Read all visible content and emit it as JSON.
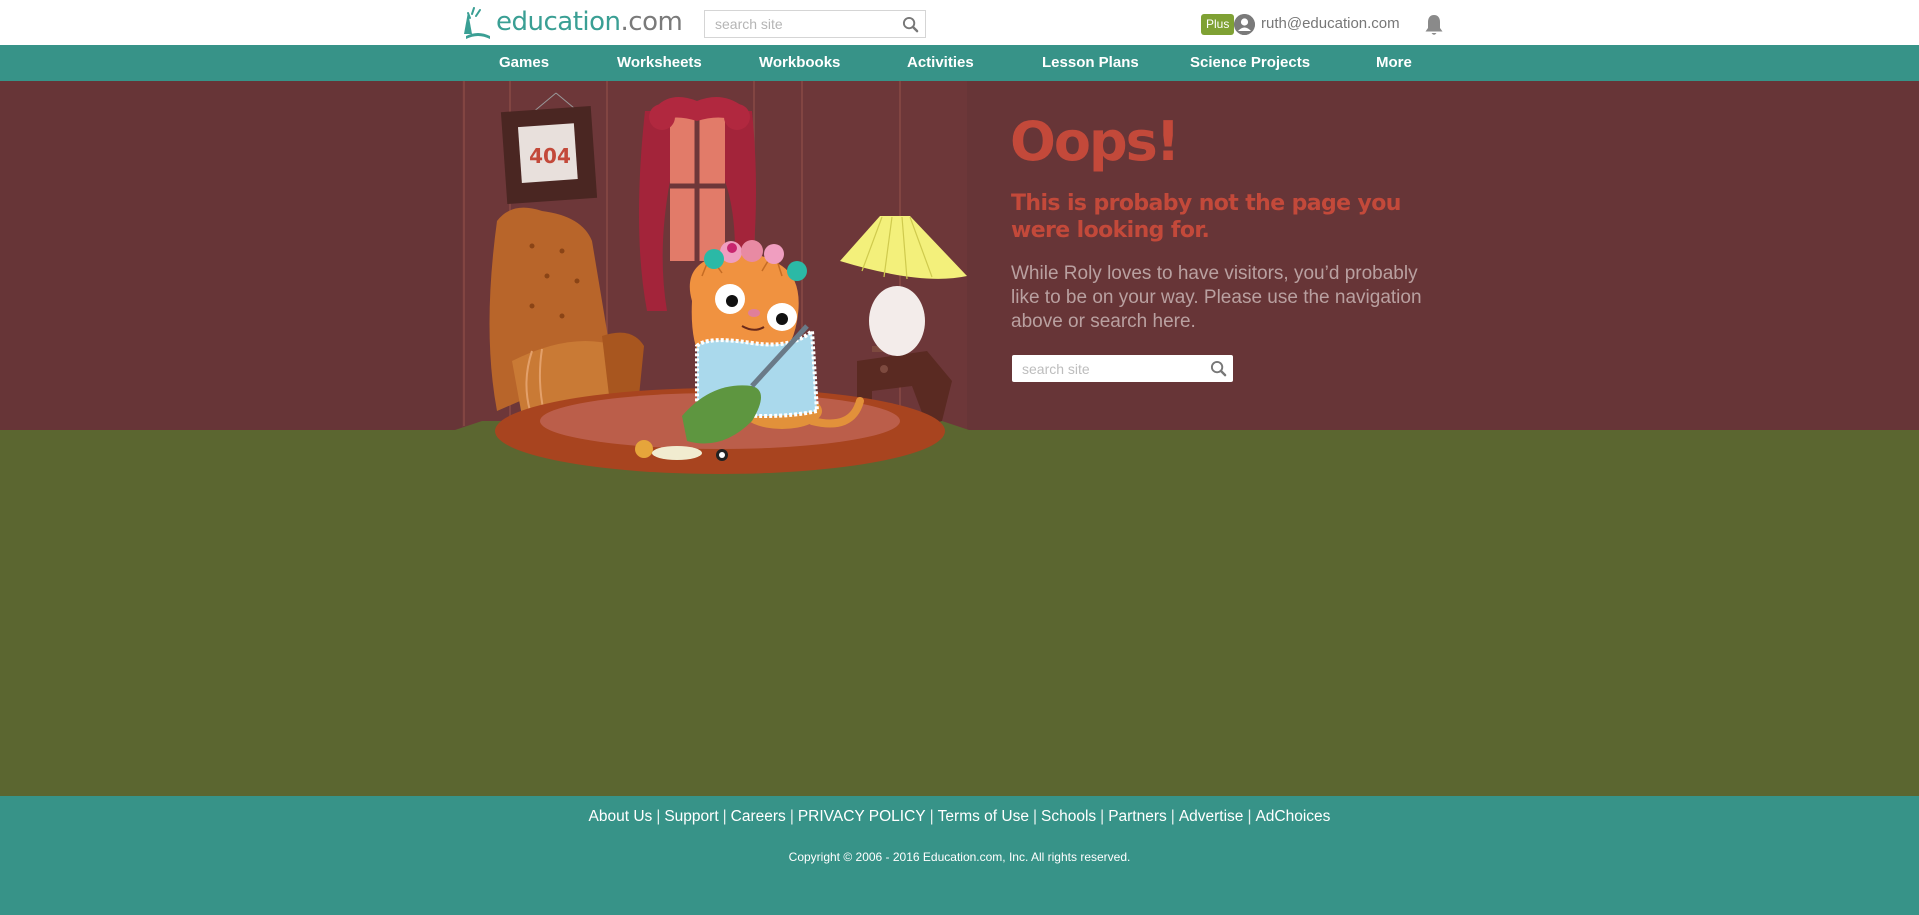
{
  "header": {
    "logo_text": "education",
    "logo_suffix": ".com",
    "search_placeholder": "search site",
    "plus_label": "Plus",
    "user_email": "ruth@education.com"
  },
  "nav": {
    "items": [
      {
        "label": "Games"
      },
      {
        "label": "Worksheets"
      },
      {
        "label": "Workbooks"
      },
      {
        "label": "Activities"
      },
      {
        "label": "Lesson Plans"
      },
      {
        "label": "Science Projects"
      },
      {
        "label": "More"
      }
    ]
  },
  "illustration": {
    "frame_text": "404"
  },
  "message": {
    "title": "Oops!",
    "subtitle": "This is probaby not the page you were looking for.",
    "body": "While Roly loves to have visitors, you’d probably like to be on your way. Please use the navigation above or search here.",
    "search_placeholder": "search site"
  },
  "footer": {
    "links": [
      {
        "label": "About Us"
      },
      {
        "label": "Support"
      },
      {
        "label": "Careers"
      },
      {
        "label": "PRIVACY POLICY"
      },
      {
        "label": "Terms of Use"
      },
      {
        "label": "Schools"
      },
      {
        "label": "Partners"
      },
      {
        "label": "Advertise"
      },
      {
        "label": "AdChoices"
      }
    ],
    "copyright": "Copyright © 2006 - 2016 Education.com, Inc. All rights reserved."
  },
  "colors": {
    "teal": "#379388",
    "wall": "#673537",
    "ground": "#5b6630",
    "accent_red": "#c3493a",
    "plus_green": "#7fa134"
  }
}
